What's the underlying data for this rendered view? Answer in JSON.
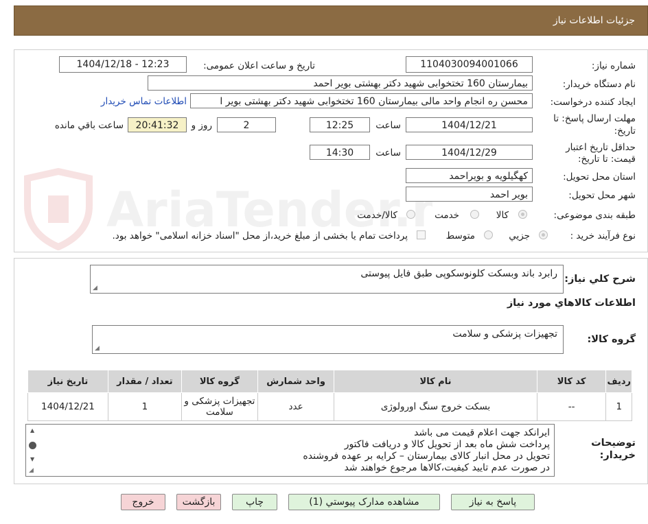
{
  "header": {
    "title": "جزئیات اطلاعات نیاز"
  },
  "fields": {
    "need_number_label": "شماره نیاز:",
    "need_number": "1104030094001066",
    "announce_label": "تاریخ و ساعت اعلان عمومی:",
    "announce_value": "1404/12/18 - 12:23",
    "buyer_label": "نام دستگاه خریدار:",
    "buyer_value": "بیمارستان 160 تختخوابی شهید دکتر بهشتی بویر احمد",
    "creator_label": "ایجاد کننده درخواست:",
    "creator_value": "محسن ره انجام واحد مالی بیمارستان 160 تختخوابی شهید دکتر بهشتی بویر ا",
    "contact_link": "اطلاعات تماس خریدار",
    "deadline_label_1": "مهلت ارسال پاسخ: تا",
    "deadline_label_2": "تاریخ:",
    "deadline_date": "1404/12/21",
    "hour_label": "ساعت",
    "deadline_time": "12:25",
    "days_value": "2",
    "days_label": "روز و",
    "remaining_time": "20:41:32",
    "remaining_label": "ساعت باقي مانده",
    "validity_label_1": "حداقل تاریخ اعتبار",
    "validity_label_2": "قیمت: تا تاریخ:",
    "validity_date": "1404/12/29",
    "validity_time": "14:30",
    "province_label": "استان محل تحویل:",
    "province_value": "کهگیلویه و بویراحمد",
    "city_label": "شهر محل تحویل:",
    "city_value": "بویر احمد",
    "category_label": "طبقه بندی موضوعی:",
    "category_options": [
      "کالا",
      "خدمت",
      "کالا/خدمت"
    ],
    "process_label": "نوع فرآیند خرید :",
    "process_options": [
      "جزیي",
      "متوسط"
    ],
    "payment_note": "پرداخت تمام یا بخشی از مبلغ خرید،از محل \"اسناد خزانه اسلامی\" خواهد بود."
  },
  "summary": {
    "label": "شرح کلي نياز:",
    "value": "رابرد باند وبسکت کلونوسکوپی طبق فایل پیوستی"
  },
  "goods_info_title": "اطلاعات کالاهاي مورد نياز",
  "goods_group": {
    "label": "گروه کالا:",
    "value": "تجهیزات پزشکی و سلامت"
  },
  "table": {
    "headers": [
      "رديف",
      "کد کالا",
      "نام کالا",
      "واحد شمارش",
      "گروه کالا",
      "تعداد / مقدار",
      "تاریخ نیاز"
    ],
    "rows": [
      [
        "1",
        "--",
        "بسکت خروج سنگ اورولوژی",
        "عدد",
        "تجهیزات پزشکی و سلامت",
        "1",
        "1404/12/21"
      ]
    ]
  },
  "buyer_notes": {
    "label_1": "توضیحات",
    "label_2": "خریدار:",
    "lines": [
      "ایرانکد جهت اعلام قیمت می باشد",
      "پرداخت شش ماه بعد از تحویل کالا و دریافت فاکتور",
      "تحویل در محل انبار کالای بیمارستان – کرایه بر عهده فروشنده",
      "در صورت عدم تایید کیفیت،کالاها مرجوع خواهند شد"
    ]
  },
  "buttons": {
    "reply": "پاسخ به نیاز",
    "attachments": "مشاهده مدارک پیوستي (1)",
    "print": "چاپ",
    "back": "بازگشت",
    "exit": "خروج"
  },
  "watermark": {
    "text": "AriaTender.neT"
  },
  "colors": {
    "header_bg": "#8b6b43",
    "green_button": "#dff3dc",
    "pink_button": "#f6d4d6",
    "remaining_bg": "#f6f1c7",
    "link": "#1f4bb5"
  }
}
